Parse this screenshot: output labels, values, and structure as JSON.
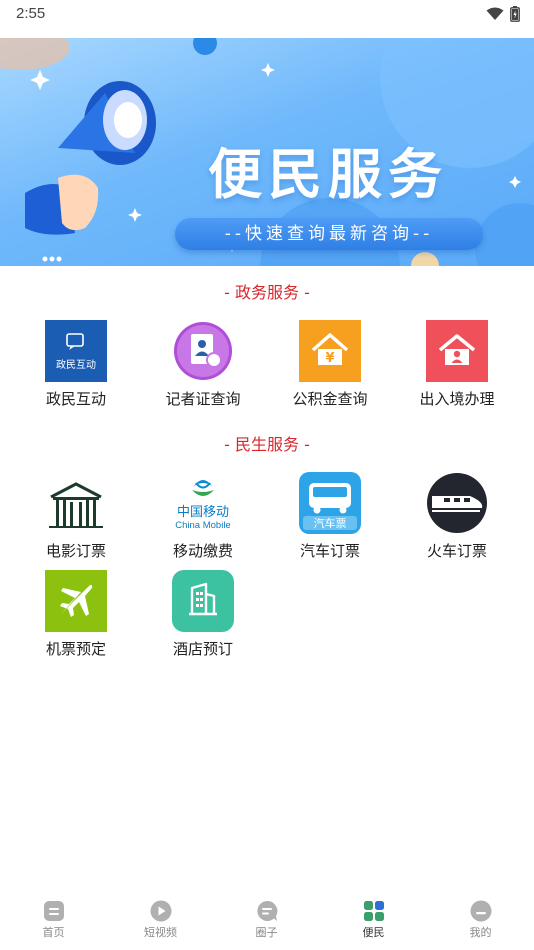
{
  "status_bar": {
    "time": "2:55"
  },
  "banner": {
    "title": "便民服务",
    "subtitle": "--快速查询最新咨询--"
  },
  "sections": [
    {
      "title": "- 政务服务 -",
      "items": [
        {
          "label": "政民互动",
          "icon": "government-interaction-icon",
          "icon_text": "政民互动"
        },
        {
          "label": "记者证查询",
          "icon": "press-card-icon"
        },
        {
          "label": "公积金查询",
          "icon": "housing-fund-icon"
        },
        {
          "label": "出入境办理",
          "icon": "exit-entry-icon"
        }
      ]
    },
    {
      "title": "- 民生服务 -",
      "items": [
        {
          "label": "电影订票",
          "icon": "cinema-icon"
        },
        {
          "label": "移动缴费",
          "icon": "china-mobile-icon",
          "icon_text": "中国移动",
          "icon_subtext": "China Mobile"
        },
        {
          "label": "汽车订票",
          "icon": "bus-icon",
          "icon_text": "汽车票"
        },
        {
          "label": "火车订票",
          "icon": "train-icon"
        },
        {
          "label": "机票预定",
          "icon": "airplane-icon"
        },
        {
          "label": "酒店预订",
          "icon": "hotel-icon"
        }
      ]
    }
  ],
  "bottom_nav": [
    {
      "label": "首页",
      "icon": "home-icon",
      "active": false
    },
    {
      "label": "短视频",
      "icon": "play-icon",
      "active": false
    },
    {
      "label": "圈子",
      "icon": "chat-icon",
      "active": false
    },
    {
      "label": "便民",
      "icon": "grid-icon",
      "active": true
    },
    {
      "label": "我的",
      "icon": "profile-icon",
      "active": false
    }
  ],
  "colors": {
    "accent_red": "#d9262c",
    "banner_blue": "#5aaaf8",
    "nav_active_green": "#3a9f6a"
  }
}
